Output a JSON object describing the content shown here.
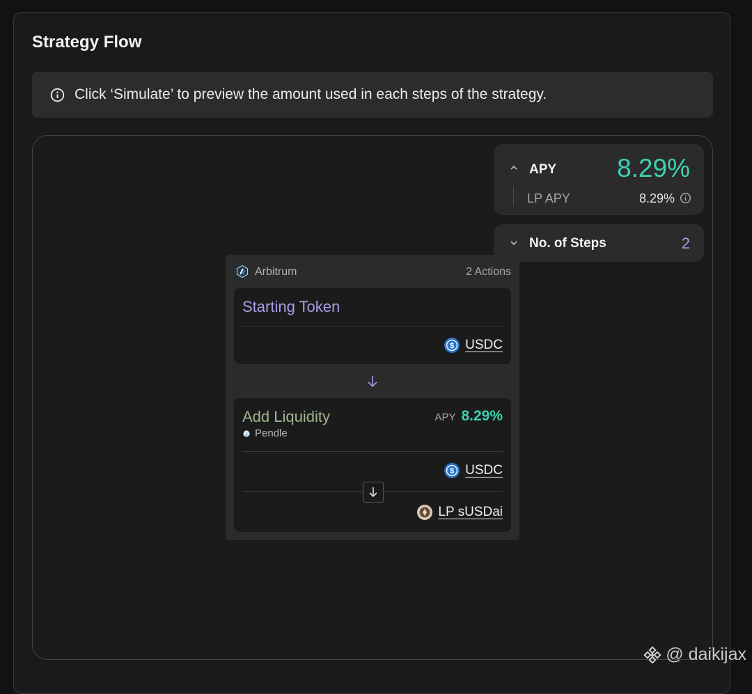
{
  "panel": {
    "title": "Strategy Flow"
  },
  "notice": {
    "text": "Click ‘Simulate’ to preview the amount used in each steps of the strategy."
  },
  "apy": {
    "label": "APY",
    "value": "8.29%",
    "lp_label": "LP APY",
    "lp_value": "8.29%"
  },
  "steps": {
    "label": "No. of Steps",
    "value": "2"
  },
  "flow": {
    "chain": "Arbitrum",
    "actions": "2 Actions",
    "step1": {
      "title": "Starting Token",
      "token": "USDC"
    },
    "step2": {
      "title": "Add Liquidity",
      "protocol": "Pendle",
      "apy_label": "APY",
      "apy_value": "8.29%",
      "input_token": "USDC",
      "output_token": "LP sUSDai"
    }
  },
  "watermark": {
    "text": "@ daikijax"
  },
  "colors": {
    "accent_green": "#3fd2b1",
    "accent_purple": "#a89de6",
    "step2_title": "#a2b58c",
    "usdc_blue": "#2775ca"
  },
  "icons": [
    "info-icon",
    "chevron-up-icon",
    "chevron-down-icon",
    "arbitrum-icon",
    "usdc-icon",
    "arrow-down-icon",
    "pendle-icon",
    "susdai-icon",
    "binance-icon"
  ]
}
